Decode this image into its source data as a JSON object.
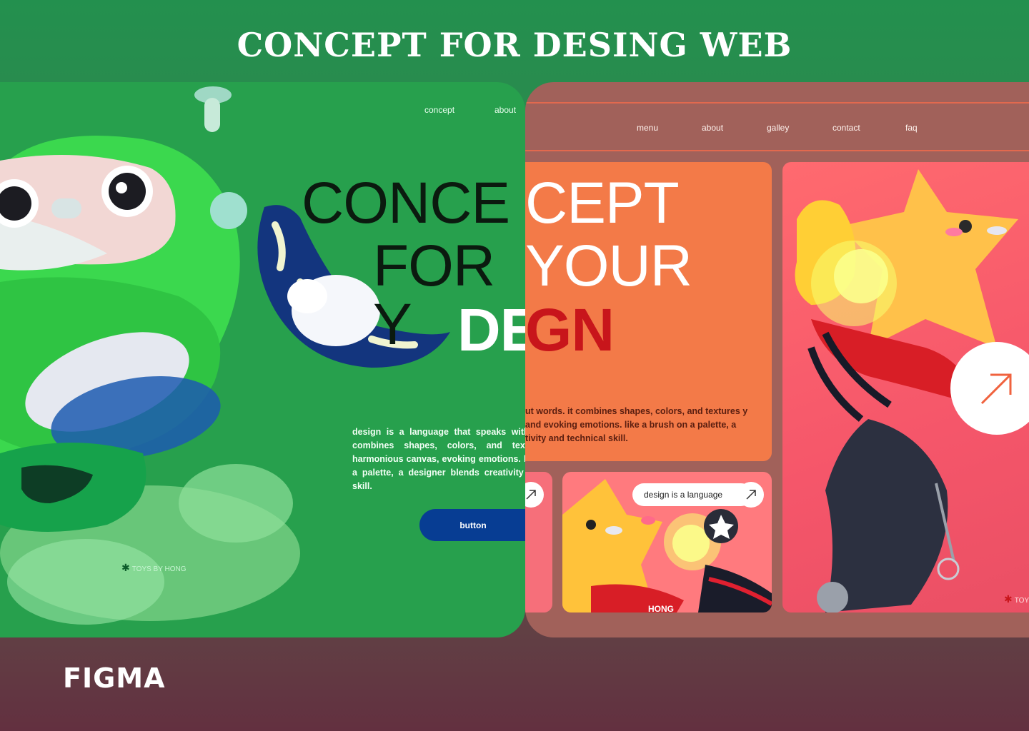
{
  "title": "CONCEPT FOR DESING WEB",
  "brand": "FIGMA",
  "green_page": {
    "nav": [
      "concept",
      "about"
    ],
    "body": "design is a language that speaks without words. it combines shapes, colors, and textures into a harmonious canvas, evoking emotions. like a brush on a palette, a designer blends creativity and technical skill.",
    "button_label": "button",
    "brand_label": "TOYS BY HONG",
    "hero": [
      "CONCE",
      "FOR Y",
      "DE"
    ],
    "colors": {
      "bg": "#27a04d",
      "button": "#073d93"
    }
  },
  "rose_page": {
    "nav": [
      "menu",
      "about",
      "galley",
      "contact",
      "faq"
    ],
    "hero": [
      "CEPT",
      "YOUR",
      "GN"
    ],
    "body": "ut words. it combines shapes, colors, and textures y and evoking emotions. like a brush on a palette, a tivity and technical skill.",
    "pill_label": "design is a language",
    "brand_label": "TOYS",
    "mini_brand": "HONG",
    "colors": {
      "bg": "#a1615a",
      "card": "#f37a48",
      "accent": "#c8151b"
    }
  },
  "icons": [
    "arrow-up-right-icon",
    "asterisk-icon",
    "star-icon"
  ]
}
